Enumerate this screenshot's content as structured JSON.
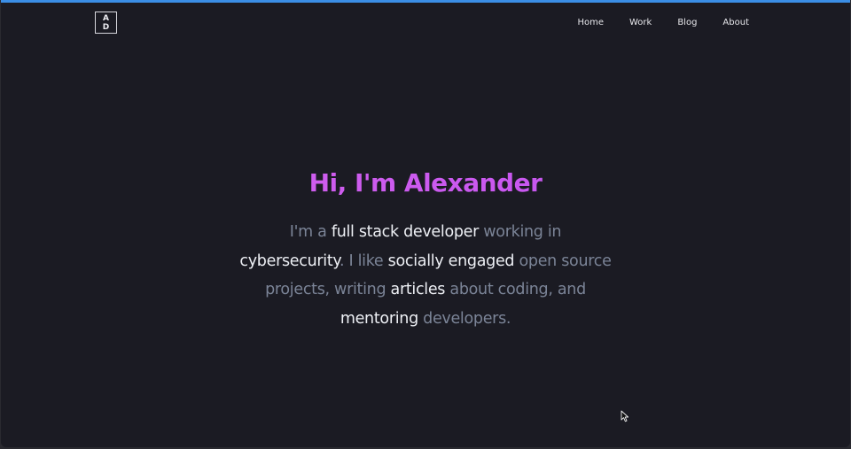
{
  "accent_colors": {
    "top_strip": "#3b8ee6",
    "title_gradient_start": "#d764ec",
    "title_gradient_end": "#c050f2",
    "muted_text": "#7b8497",
    "highlight_text": "#eef0f5",
    "background": "#1b1b23"
  },
  "logo": {
    "line1": "A",
    "line2": "D"
  },
  "nav": {
    "items": [
      {
        "label": "Home"
      },
      {
        "label": "Work"
      },
      {
        "label": "Blog"
      },
      {
        "label": "About"
      }
    ]
  },
  "hero": {
    "title": "Hi, I'm Alexander",
    "intro": {
      "p1": "I'm a ",
      "e1": "full stack developer",
      "p2": " working in ",
      "e2": "cybersecurity",
      "p3": ". I like ",
      "e3": "socially engaged",
      "p4": " open source projects, writing ",
      "e4": "articles",
      "p5": " about coding, and ",
      "e5": "mentoring",
      "p6": " developers."
    }
  },
  "cursor_icon": "mouse-pointer-icon"
}
